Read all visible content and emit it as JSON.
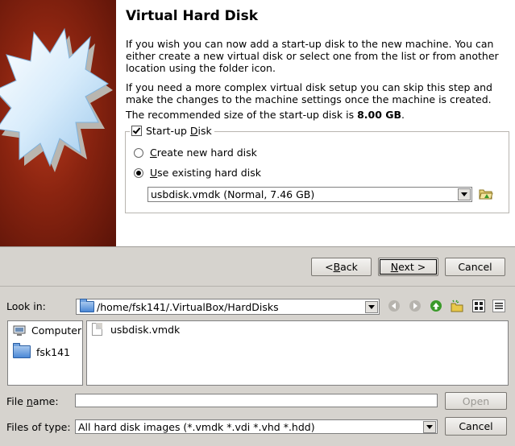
{
  "wizard": {
    "title": "Virtual Hard Disk",
    "para1": "If you wish you can now add a start-up disk to the new machine. You can either create a new virtual disk or select one from the list or from another location using the folder icon.",
    "para2": "If you need a more complex virtual disk setup you can skip this step and make the changes to the machine settings once the machine is created.",
    "para3_prefix": "The recommended size of the start-up disk is ",
    "para3_size": "8.00 GB",
    "para3_suffix": ".",
    "startup_disk_label_pre": "Start-up ",
    "startup_disk_label_ul": "D",
    "startup_disk_label_post": "isk",
    "startup_disk_checked": true,
    "create_new_pre": "",
    "create_new_ul": "C",
    "create_new_post": "reate new hard disk",
    "use_existing_pre": "",
    "use_existing_ul": "U",
    "use_existing_post": "se existing hard disk",
    "selected_option": "use_existing",
    "disk_selected": "usbdisk.vmdk (Normal, 7.46 GB)",
    "back_pre": "< ",
    "back_ul": "B",
    "back_post": "ack",
    "next_ul": "N",
    "next_post": "ext >",
    "cancel": "Cancel",
    "folder_icon": "folder-open-icon"
  },
  "file_dialog": {
    "look_in_label": "Look in:",
    "path": "/home/fsk141/.VirtualBox/HardDisks",
    "toolbar_icons": [
      "back-arrow-icon",
      "forward-arrow-icon",
      "up-arrow-icon",
      "new-folder-icon",
      "list-view-icon",
      "detail-view-icon"
    ],
    "sidebar": [
      {
        "label": "Computer",
        "icon": "computer-icon"
      },
      {
        "label": "fsk141",
        "icon": "folder-icon"
      }
    ],
    "files": [
      {
        "name": "usbdisk.vmdk",
        "icon": "file-icon"
      }
    ],
    "file_name_label_pre": "File ",
    "file_name_label_ul": "n",
    "file_name_label_post": "ame:",
    "file_name_value": "",
    "open_label": "Open",
    "files_of_type_label": "Files of type:",
    "files_of_type_value": "All hard disk images (*.vmdk *.vdi *.vhd *.hdd)",
    "cancel_label": "Cancel"
  }
}
